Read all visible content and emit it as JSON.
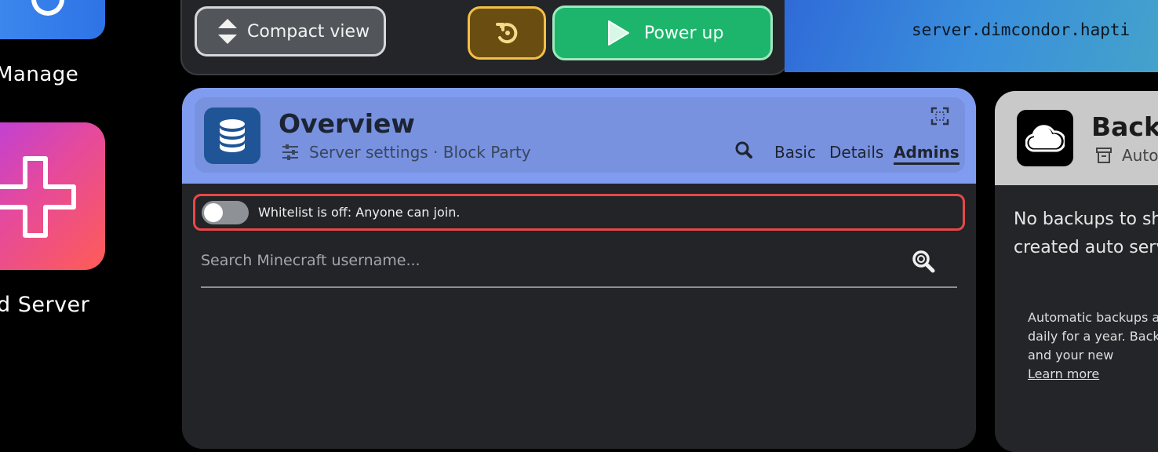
{
  "sidebar": {
    "manage_label": "Manage",
    "add_server_label": "d Server"
  },
  "toolbar": {
    "compact_label": "Compact view",
    "power_label": "Power up",
    "address": "server.dimcondor.hapti"
  },
  "overview": {
    "title": "Overview",
    "subtitle": "Server settings · Block Party",
    "tabs": [
      "Basic",
      "Details",
      "Admins"
    ],
    "active_tab": "Admins",
    "whitelist_text": "Whitelist is off: Anyone can join.",
    "whitelist_on": false,
    "search_placeholder": "Search Minecraft username..."
  },
  "backups": {
    "title": "Back",
    "subtitle": "Auto",
    "message": "No backups to sh are created auto server runs.",
    "note": "Automatic backups a days, then daily for a year. Backups you c years, and your new",
    "learn_more": "Learn more"
  },
  "colors": {
    "power_green": "#1db56c",
    "restart_gold": "#f2c046",
    "overview_blue": "#7f9cf0",
    "whitelist_border": "#e64848"
  },
  "icons": {
    "compact": "compact-view-icon",
    "restart": "restart-icon",
    "power": "play-icon",
    "database": "database-icon",
    "settings": "sliders-icon",
    "expand": "expand-icon",
    "search": "search-icon",
    "cloud": "cloud-icon",
    "archive": "archive-icon"
  }
}
